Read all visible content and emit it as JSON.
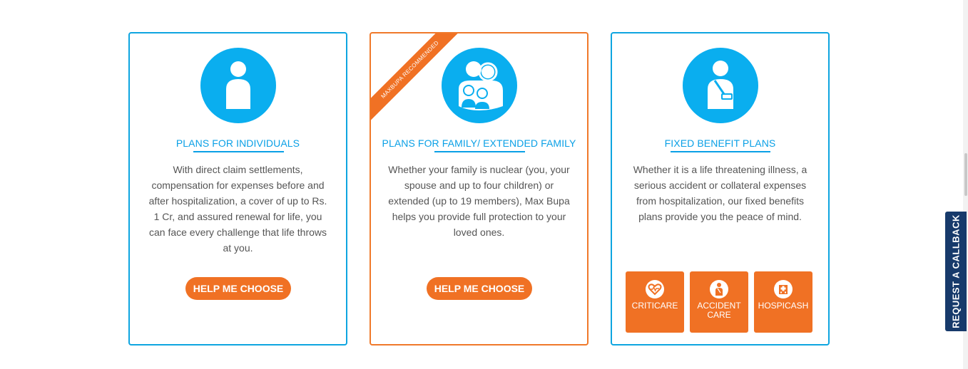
{
  "cards": [
    {
      "title": "PLANS FOR INDIVIDUALS",
      "description": "With direct claim settlements, compensation for expenses before and after hospitalization, a cover of up to Rs. 1 Cr, and assured renewal for life, you can face every challenge that life throws at you.",
      "button_label": "HELP ME CHOOSE",
      "icon": "person-icon"
    },
    {
      "title": "PLANS FOR FAMILY/ EXTENDED FAMILY",
      "description": "Whether your family is nuclear (you, your spouse and up to four children) or extended (up to 19 members), Max Bupa helps you provide full protection to your loved ones.",
      "button_label": "HELP ME CHOOSE",
      "ribbon": "MAXBUPA RECOMMENDED",
      "icon": "family-icon"
    },
    {
      "title": "FIXED BENEFIT PLANS",
      "description": "Whether it is a life threatening illness, a serious accident or collateral expenses from hospitalization, our fixed benefits plans provide you the peace of mind.",
      "icon": "injured-person-icon",
      "tiles": [
        {
          "label": "CRITICARE",
          "icon": "heart-pulse-icon"
        },
        {
          "label": "ACCIDENT CARE",
          "icon": "injured-person-icon"
        },
        {
          "label": "HOSPICASH",
          "icon": "hospital-icon"
        }
      ]
    }
  ],
  "callback_label": "REQUEST A CALLBACK",
  "colors": {
    "blue": "#0aaeef",
    "orange": "#f07124",
    "navy": "#173a6b"
  }
}
